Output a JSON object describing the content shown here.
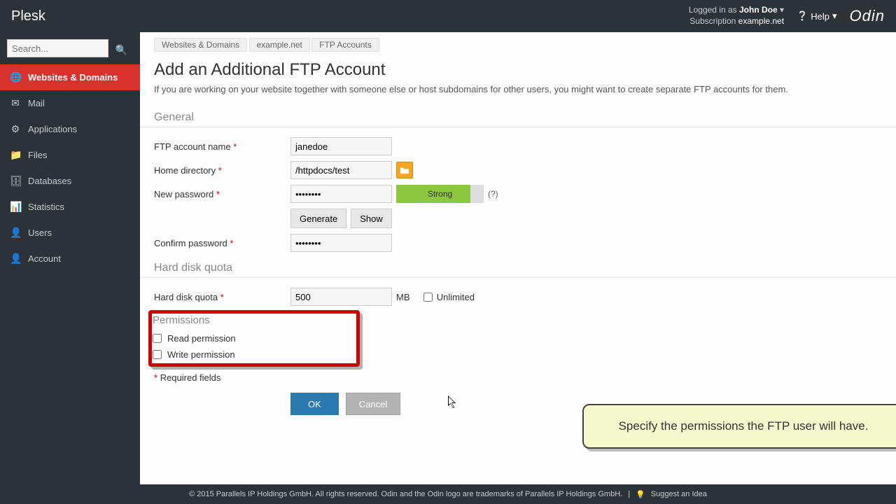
{
  "brand": "Plesk",
  "auth": {
    "logged_in_as_label": "Logged in as",
    "username": "John Doe",
    "subscription_label": "Subscription",
    "subscription_value": "example.net"
  },
  "help_label": "Help",
  "odin_label": "Odin",
  "search": {
    "placeholder": "Search..."
  },
  "sidebar": {
    "items": [
      {
        "label": "Websites & Domains"
      },
      {
        "label": "Mail"
      },
      {
        "label": "Applications"
      },
      {
        "label": "Files"
      },
      {
        "label": "Databases"
      },
      {
        "label": "Statistics"
      },
      {
        "label": "Users"
      },
      {
        "label": "Account"
      }
    ]
  },
  "breadcrumb": {
    "items": [
      {
        "label": "Websites & Domains"
      },
      {
        "label": "example.net"
      },
      {
        "label": "FTP Accounts"
      }
    ]
  },
  "page": {
    "title": "Add an Additional FTP Account",
    "description": "If you are working on your website together with someone else or host subdomains for other users, you might want to create separate FTP accounts for them."
  },
  "sections": {
    "general": "General",
    "quota": "Hard disk quota",
    "permissions": "Permissions"
  },
  "fields": {
    "account_name": {
      "label": "FTP account name",
      "value": "janedoe"
    },
    "home_dir": {
      "label": "Home directory",
      "value": "/httpdocs/test"
    },
    "new_password": {
      "label": "New password",
      "value": "••••••••"
    },
    "strength_label": "Strong",
    "strength_help": "(?)",
    "generate": "Generate",
    "show": "Show",
    "confirm_password": {
      "label": "Confirm password",
      "value": "••••••••"
    },
    "quota": {
      "label": "Hard disk quota",
      "value": "500",
      "unit": "MB",
      "unlimited_label": "Unlimited"
    },
    "read_permission": "Read permission",
    "write_permission": "Write permission"
  },
  "required_note": "Required fields",
  "buttons": {
    "ok": "OK",
    "cancel": "Cancel"
  },
  "tooltip": "Specify the permissions the FTP user will have.",
  "footer": {
    "copyright": "© 2015 Parallels IP Holdings GmbH. All rights reserved. Odin and the Odin logo are trademarks of Parallels IP Holdings GmbH.",
    "suggest": "Suggest an Idea"
  }
}
